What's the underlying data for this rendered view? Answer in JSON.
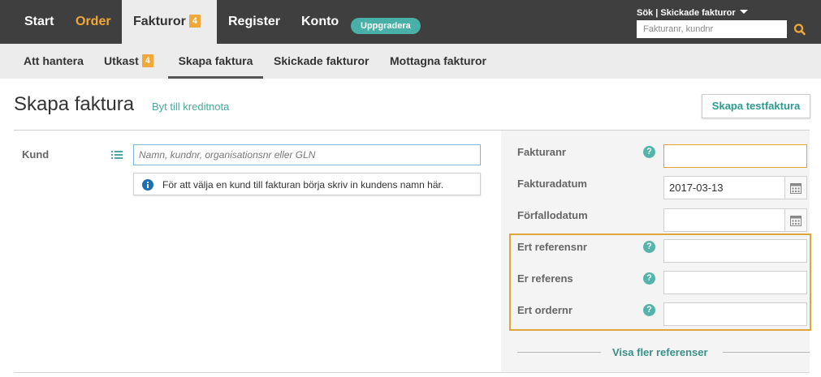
{
  "topnav": {
    "start": "Start",
    "order": "Order",
    "fakturor": "Fakturor",
    "fakturor_badge": "4",
    "register": "Register",
    "konto": "Konto",
    "upgrade": "Uppgradera"
  },
  "search": {
    "scope": "Sök | Skickade fakturor",
    "placeholder": "Fakturanr, kundnr",
    "icon": "search-icon"
  },
  "subnav": {
    "att_hantera": "Att hantera",
    "utkast": "Utkast",
    "utkast_badge": "4",
    "skapa_faktura": "Skapa faktura",
    "skickade": "Skickade fakturor",
    "mottagna": "Mottagna fakturor"
  },
  "page": {
    "title": "Skapa faktura",
    "switch_link": "Byt till kreditnota",
    "test_button": "Skapa testfaktura"
  },
  "customer": {
    "label": "Kund",
    "placeholder": "Namn, kundnr, organisationsnr eller GLN",
    "hint": "För att välja en kund till fakturan börja skriv in kundens namn här."
  },
  "invoice_form": {
    "fakturanr_label": "Fakturanr",
    "fakturanr_value": "",
    "fakturadatum_label": "Fakturadatum",
    "fakturadatum_value": "2017-03-13",
    "forfallodatum_label": "Förfallodatum",
    "forfallodatum_value": "",
    "ert_referensnr_label": "Ert referensnr",
    "er_referens_label": "Er referens",
    "ert_ordernr_label": "Ert ordernr",
    "help_glyph": "?",
    "more_refs": "Visa fler referenser"
  },
  "colors": {
    "nav_bg": "#3f3f3f",
    "accent_orange": "#f0a83a",
    "accent_teal": "#49b0a8"
  }
}
